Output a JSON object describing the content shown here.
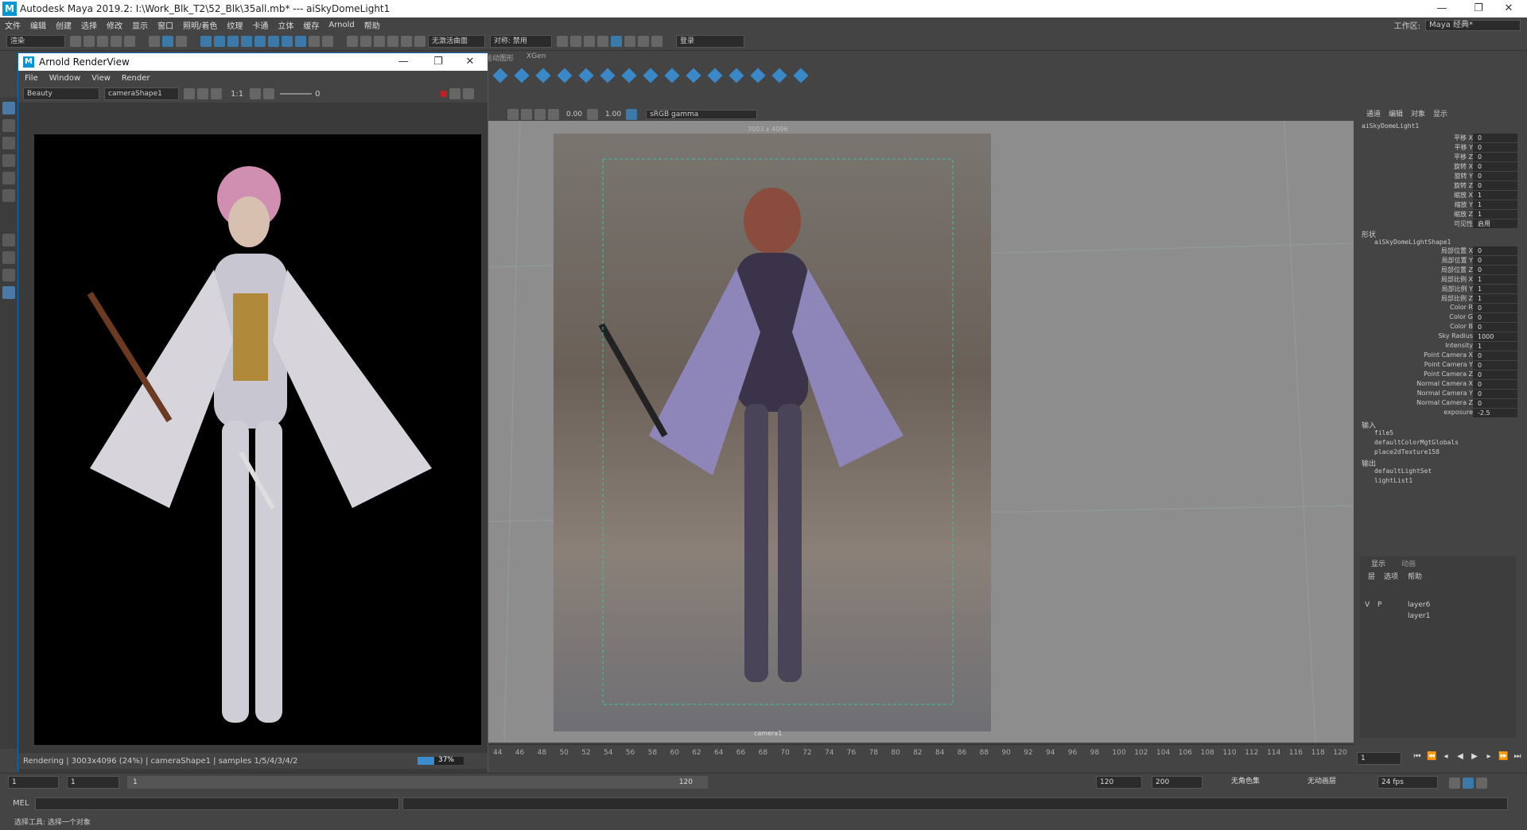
{
  "app": {
    "title": "Autodesk Maya 2019.2: I:\\Work_Blk_T2\\52_Blk\\35all.mb*   ---   aiSkyDomeLight1",
    "logo": "M",
    "menus": [
      "文件",
      "编辑",
      "创建",
      "选择",
      "修改",
      "显示",
      "窗口",
      "照明/着色",
      "纹理",
      "卡通",
      "立体",
      "缓存",
      "Arnold",
      "帮助"
    ],
    "workspace_label": "工作区:",
    "workspace_value": "Maya 经典*",
    "window_buttons": [
      "—",
      "❐",
      "✕"
    ]
  },
  "statusline": {
    "mode": "渲染",
    "live_surface": "无激活曲面",
    "symmetry": "对称: 禁用",
    "login": "登录"
  },
  "shelf": {
    "tabs": [
      "运动图形",
      "XGen"
    ]
  },
  "renderview": {
    "title": "Arnold RenderView",
    "logo": "M",
    "menus": [
      "File",
      "Window",
      "View",
      "Render"
    ],
    "aov": "Beauty",
    "camera": "cameraShape1",
    "ratio": "1:1",
    "exposure": "0",
    "status": "Rendering | 3003x4096 (24%) | cameraShape1 | samples 1/5/4/3/4/2",
    "progress_text": "37%",
    "progress": 0.37
  },
  "viewport": {
    "exposure": "0.00",
    "gamma_value": "1.00",
    "color_space": "sRGB gamma",
    "resolution": "3003 x 4096",
    "camera": "camera1"
  },
  "channelbox": {
    "tabs": [
      "通道",
      "编辑",
      "对象",
      "显示"
    ],
    "node": "aiSkyDomeLight1",
    "transform": [
      {
        "label": "平移 X",
        "value": "0"
      },
      {
        "label": "平移 Y",
        "value": "0"
      },
      {
        "label": "平移 Z",
        "value": "0"
      },
      {
        "label": "旋转 X",
        "value": "0"
      },
      {
        "label": "旋转 Y",
        "value": "0"
      },
      {
        "label": "旋转 Z",
        "value": "0"
      },
      {
        "label": "缩放 X",
        "value": "1"
      },
      {
        "label": "缩放 Y",
        "value": "1"
      },
      {
        "label": "缩放 Z",
        "value": "1"
      },
      {
        "label": "可见性",
        "value": "启用"
      }
    ],
    "shapes_header": "形状",
    "shape_node": "aiSkyDomeLightShape1",
    "shape_attrs": [
      {
        "label": "局部位置 X",
        "value": "0"
      },
      {
        "label": "局部位置 Y",
        "value": "0"
      },
      {
        "label": "局部位置 Z",
        "value": "0"
      },
      {
        "label": "局部比例 X",
        "value": "1"
      },
      {
        "label": "局部比例 Y",
        "value": "1"
      },
      {
        "label": "局部比例 Z",
        "value": "1"
      },
      {
        "label": "Color R",
        "value": "0"
      },
      {
        "label": "Color G",
        "value": "0"
      },
      {
        "label": "Color B",
        "value": "0"
      },
      {
        "label": "Sky Radius",
        "value": "1000"
      },
      {
        "label": "Intensity",
        "value": "1"
      },
      {
        "label": "Point Camera X",
        "value": "0"
      },
      {
        "label": "Point Camera Y",
        "value": "0"
      },
      {
        "label": "Point Camera Z",
        "value": "0"
      },
      {
        "label": "Normal Camera X",
        "value": "0"
      },
      {
        "label": "Normal Camera Y",
        "value": "0"
      },
      {
        "label": "Normal Camera Z",
        "value": "0"
      },
      {
        "label": "exposure",
        "value": "-2.5"
      }
    ],
    "inputs_header": "输入",
    "inputs": [
      "file5",
      "defaultColorMgtGlobals",
      "place2dTexture158"
    ],
    "outputs_header": "输出",
    "outputs": [
      "defaultLightSet",
      "lightList1"
    ]
  },
  "layers": {
    "tabs": [
      "显示",
      "动画"
    ],
    "menus": [
      "层",
      "选项",
      "帮助"
    ],
    "rows": [
      {
        "v": "V",
        "p": "P",
        "name": "layer6"
      },
      {
        "v": "",
        "p": "",
        "name": "layer1"
      }
    ]
  },
  "timeline": {
    "ticks": [
      "44",
      "46",
      "48",
      "50",
      "52",
      "54",
      "56",
      "58",
      "60",
      "62",
      "64",
      "66",
      "68",
      "70",
      "72",
      "74",
      "76",
      "78",
      "80",
      "82",
      "84",
      "86",
      "88",
      "90",
      "92",
      "94",
      "96",
      "98",
      "100",
      "102",
      "104",
      "106",
      "108",
      "110",
      "112",
      "114",
      "116",
      "118",
      "120"
    ],
    "current_frame": "1"
  },
  "range": {
    "start": "1",
    "playback_start": "1",
    "slider_start": "1",
    "slider_end": "120",
    "playback_end": "120",
    "end": "200",
    "character_set": "无角色集",
    "anim_layer": "无动画层",
    "fps": "24 fps"
  },
  "mel": {
    "label": "MEL"
  },
  "help": {
    "text": "选择工具: 选择一个对象"
  }
}
